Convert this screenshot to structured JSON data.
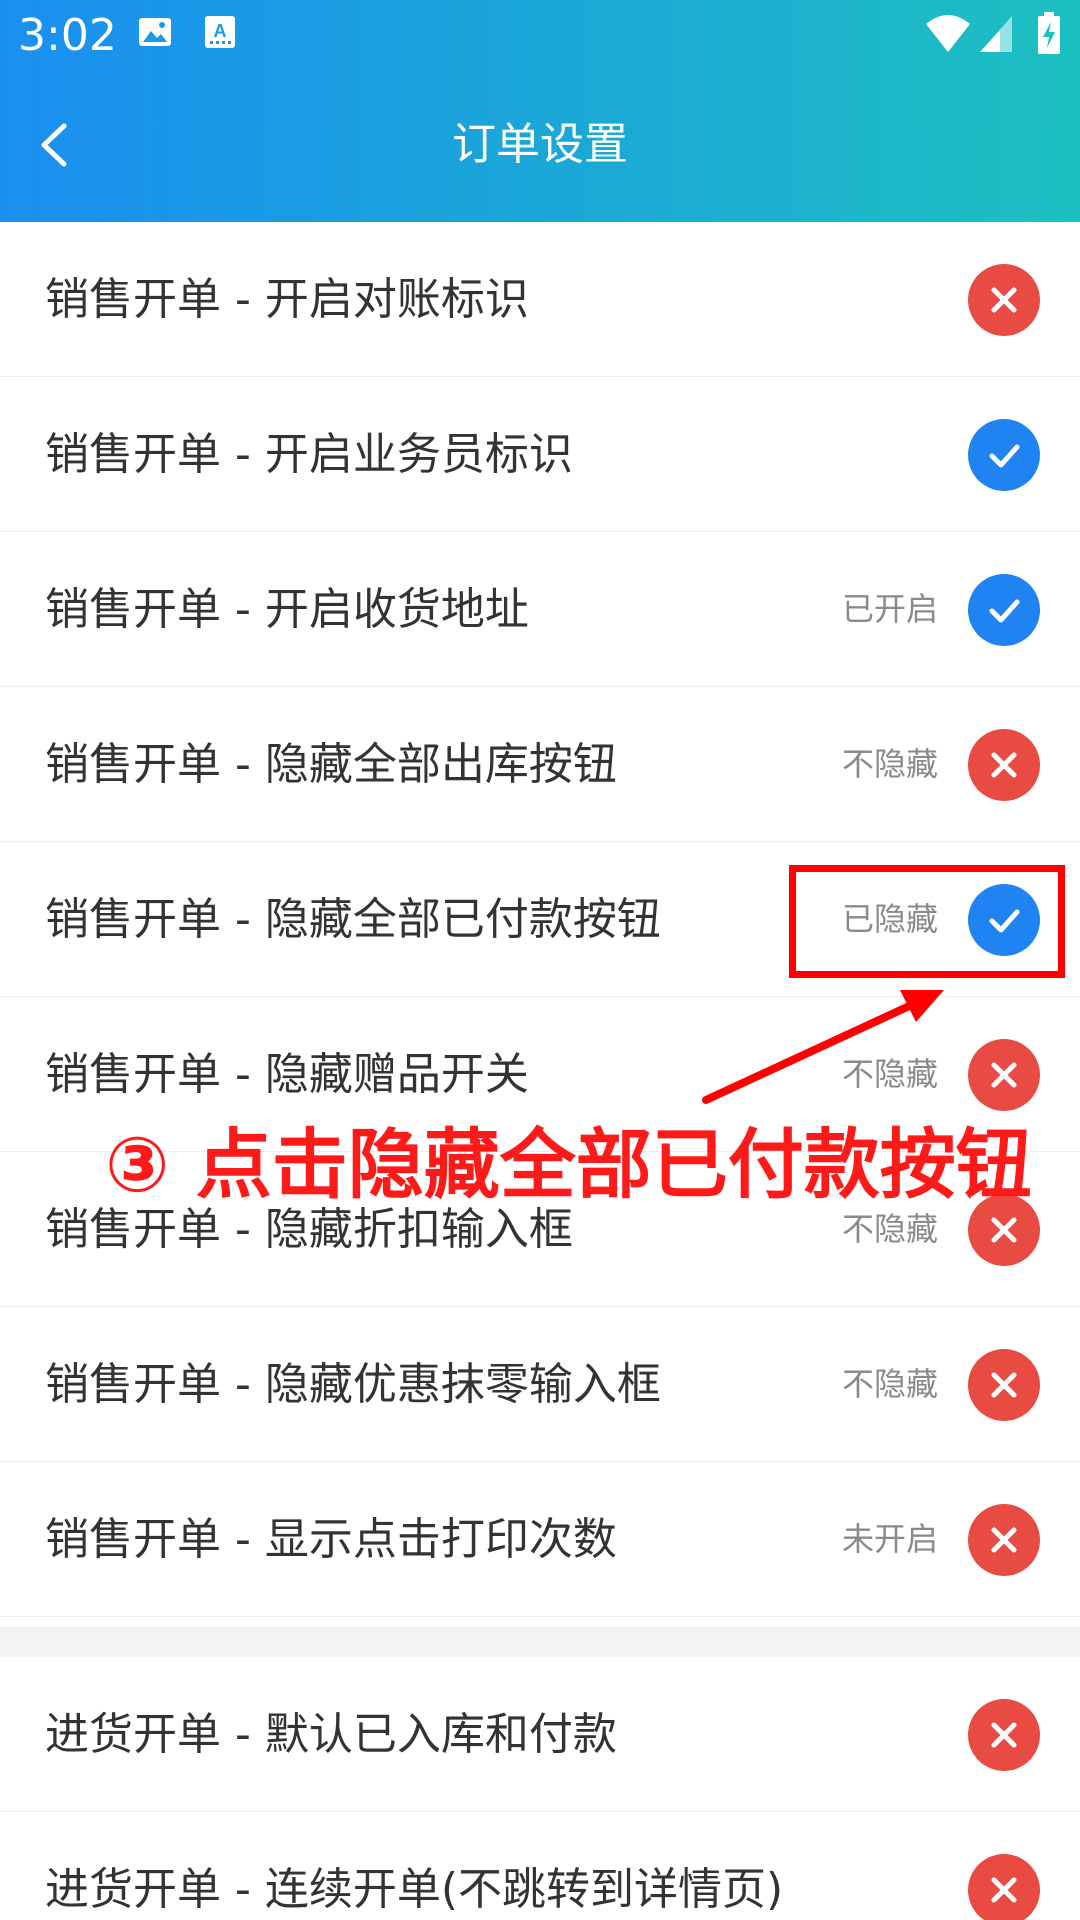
{
  "status_bar": {
    "time": "3:02",
    "icons": [
      "image-icon",
      "keyboard-a-icon",
      "wifi-icon",
      "signal-icon",
      "battery-charging-icon"
    ]
  },
  "header": {
    "title": "订单设置",
    "back_icon": "chevron-left-icon"
  },
  "colors": {
    "header_gradient_start": "#1a8ff0",
    "header_gradient_end": "#1cc0c0",
    "toggle_on": "#1f83f2",
    "toggle_off": "#e84b42",
    "annotation": "#ff0000"
  },
  "sales_settings": [
    {
      "label": "销售开单 - 开启对账标识",
      "status": "",
      "enabled": false
    },
    {
      "label": "销售开单 - 开启业务员标识",
      "status": "",
      "enabled": true
    },
    {
      "label": "销售开单 - 开启收货地址",
      "status": "已开启",
      "enabled": true
    },
    {
      "label": "销售开单 - 隐藏全部出库按钮",
      "status": "不隐藏",
      "enabled": false
    },
    {
      "label": "销售开单 - 隐藏全部已付款按钮",
      "status": "已隐藏",
      "enabled": true
    },
    {
      "label": "销售开单 - 隐藏赠品开关",
      "status": "不隐藏",
      "enabled": false
    },
    {
      "label": "销售开单 - 隐藏折扣输入框",
      "status": "不隐藏",
      "enabled": false
    },
    {
      "label": "销售开单 - 隐藏优惠抹零输入框",
      "status": "不隐藏",
      "enabled": false
    },
    {
      "label": "销售开单 - 显示点击打印次数",
      "status": "未开启",
      "enabled": false
    }
  ],
  "purchase_settings": [
    {
      "label": "进货开单 - 默认已入库和付款",
      "status": "",
      "enabled": false
    },
    {
      "label": "进货开单 - 连续开单(不跳转到详情页)",
      "status": "",
      "enabled": false
    }
  ],
  "annotation": {
    "text": "③ 点击隐藏全部已付款按钮"
  }
}
